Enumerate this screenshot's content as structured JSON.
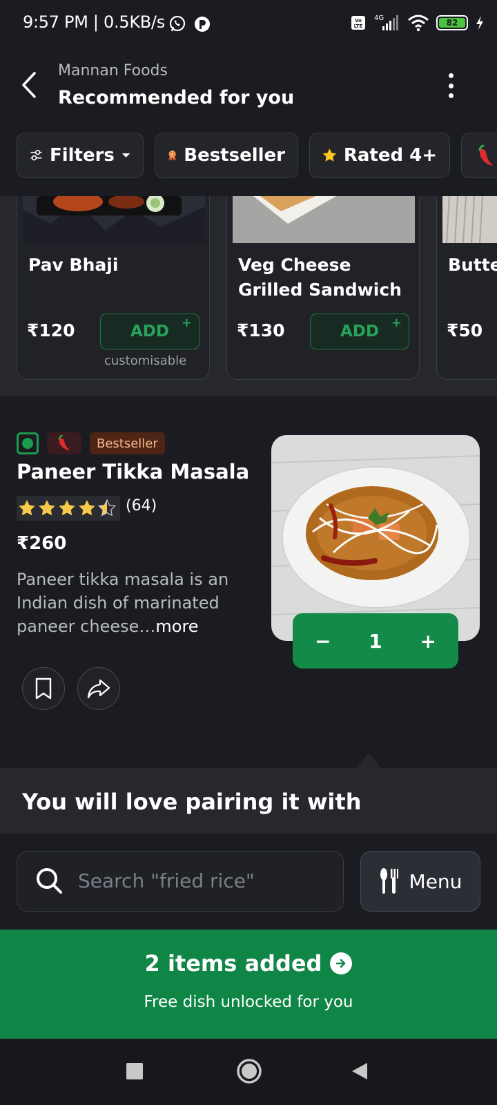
{
  "status_bar": {
    "time_speed": "9:57 PM | 0.5KB/s",
    "network": "4G",
    "volte": "Vo LTE",
    "battery": "82"
  },
  "header": {
    "restaurant": "Mannan Foods",
    "title": "Recommended for you"
  },
  "filters": [
    {
      "label": "Filters",
      "icon": "sliders-icon"
    },
    {
      "label": "Bestseller",
      "icon": "award-icon"
    },
    {
      "label": "Rated 4+",
      "icon": "star-icon"
    },
    {
      "label": "",
      "icon": "chili-icon"
    }
  ],
  "carousel": [
    {
      "name": "Pav Bhaji",
      "price": "₹120",
      "add_label": "ADD",
      "note": "customisable"
    },
    {
      "name": "Veg Cheese Grilled Sandwich",
      "price": "₹130",
      "add_label": "ADD",
      "note": ""
    },
    {
      "name": "Butte",
      "price": "₹50",
      "add_label": "",
      "note": ""
    }
  ],
  "dish": {
    "badge": "Bestseller",
    "name": "Paneer Tikka Masala",
    "rating": 4.5,
    "rating_count": "(64)",
    "price": "₹260",
    "description": "Paneer tikka masala is an Indian dish of marinated paneer cheese…",
    "more_label": "more",
    "quantity": "1",
    "minus": "−",
    "plus": "+"
  },
  "pairing": {
    "title": "You will love pairing it with"
  },
  "search": {
    "placeholder": "Search \"fried rice\"",
    "menu_label": "Menu"
  },
  "cart": {
    "title": "2 items added",
    "subtitle": "Free dish unlocked for you"
  },
  "colors": {
    "background": "#1b1c21",
    "accent_green": "#0f8645",
    "bestseller_bg": "#4e2414",
    "bestseller_text": "#f6b88e"
  }
}
